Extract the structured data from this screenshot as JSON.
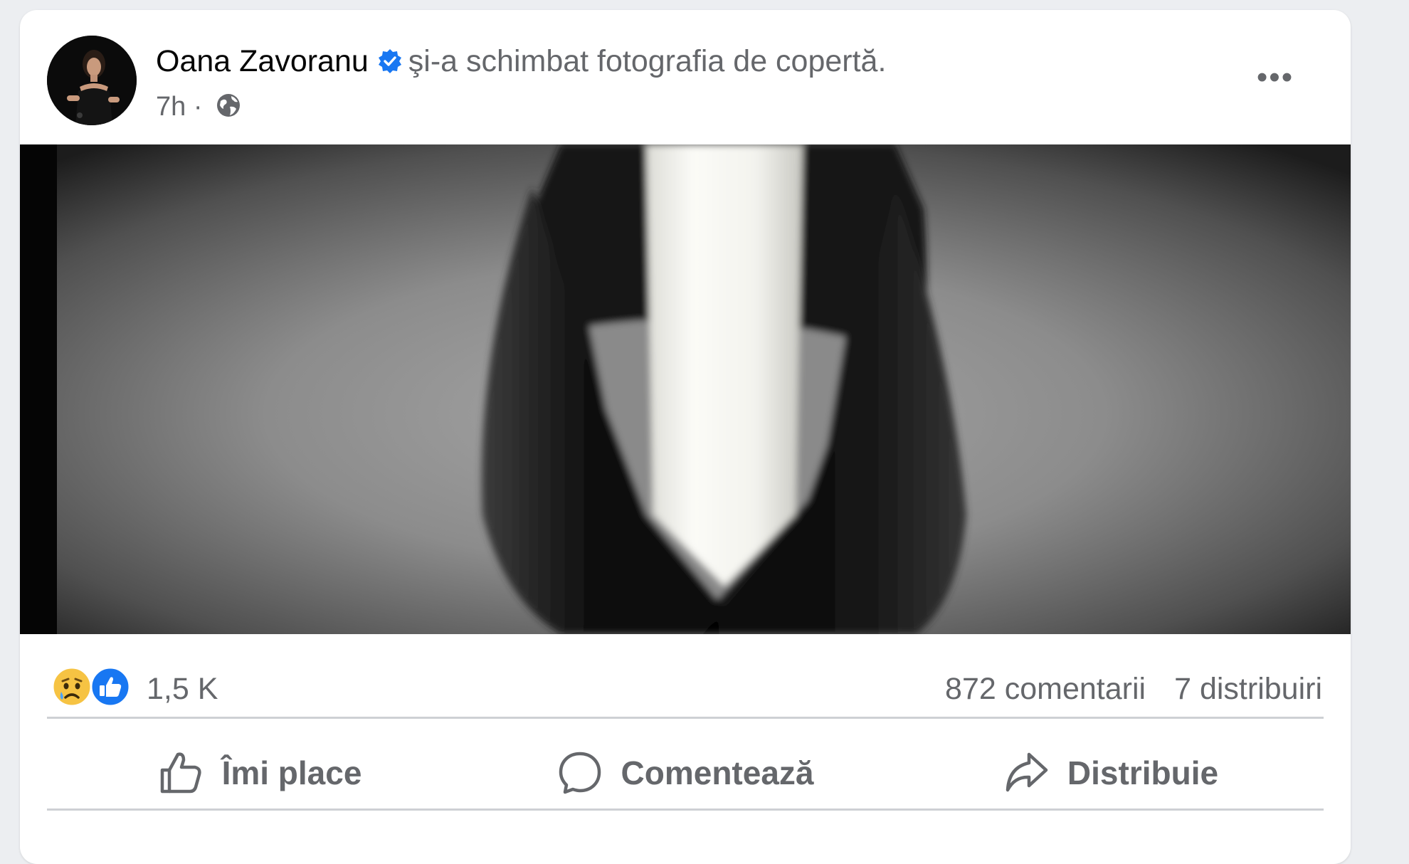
{
  "post": {
    "author_name": "Oana Zavoranu",
    "action_text": "şi-a schimbat fotografia de copertă.",
    "timestamp": "7h",
    "separator": "·",
    "privacy_icon": "globe-icon",
    "verified_icon": "verified-badge-icon",
    "more_label": "•••"
  },
  "cover": {
    "description_icon": "black-mourning-ribbon-image"
  },
  "stats": {
    "reactions": [
      "sad-reaction-icon",
      "like-reaction-icon"
    ],
    "reaction_count": "1,5 K",
    "comments": "872 comentarii",
    "shares": "7 distribuiri"
  },
  "actions": {
    "like_label": "Îmi place",
    "comment_label": "Comentează",
    "share_label": "Distribuie"
  },
  "colors": {
    "like_blue": "#1877f2",
    "verified_blue": "#1877f2",
    "secondary_text": "#65676b",
    "primary_text": "#050505",
    "divider": "#ced0d4"
  }
}
